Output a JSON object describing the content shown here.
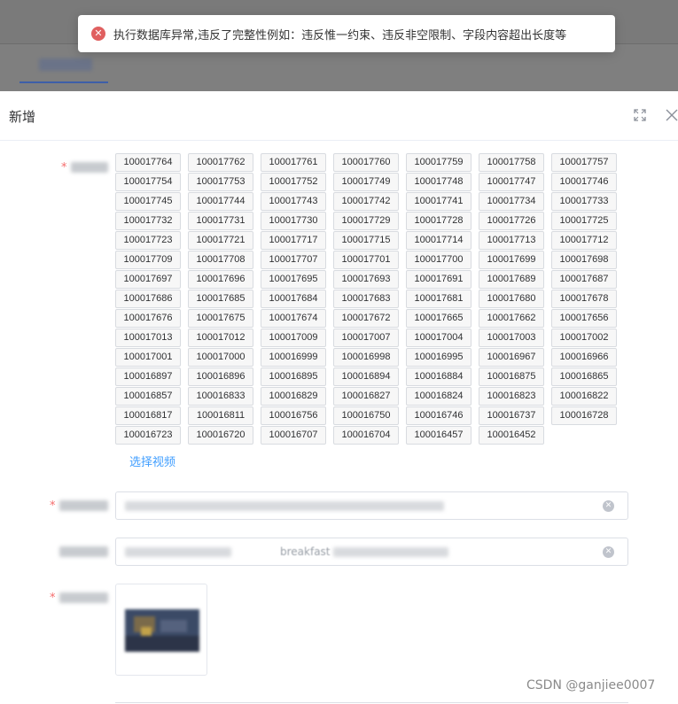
{
  "toast": {
    "icon": "error-circle-icon",
    "message": "执行数据库异常,违反了完整性例如：违反惟一约束、违反非空限制、字段内容超出长度等"
  },
  "dialog": {
    "title": "新增",
    "select_video_label": "选择视频",
    "input2_hint": "breakfast"
  },
  "video_ids": [
    "100017764",
    "100017762",
    "100017761",
    "100017760",
    "100017759",
    "100017758",
    "100017757",
    "100017754",
    "100017753",
    "100017752",
    "100017749",
    "100017748",
    "100017747",
    "100017746",
    "100017745",
    "100017744",
    "100017743",
    "100017742",
    "100017741",
    "100017734",
    "100017733",
    "100017732",
    "100017731",
    "100017730",
    "100017729",
    "100017728",
    "100017726",
    "100017725",
    "100017723",
    "100017721",
    "100017717",
    "100017715",
    "100017714",
    "100017713",
    "100017712",
    "100017709",
    "100017708",
    "100017707",
    "100017701",
    "100017700",
    "100017699",
    "100017698",
    "100017697",
    "100017696",
    "100017695",
    "100017693",
    "100017691",
    "100017689",
    "100017687",
    "100017686",
    "100017685",
    "100017684",
    "100017683",
    "100017681",
    "100017680",
    "100017678",
    "100017676",
    "100017675",
    "100017674",
    "100017672",
    "100017665",
    "100017662",
    "100017656",
    "100017013",
    "100017012",
    "100017009",
    "100017007",
    "100017004",
    "100017003",
    "100017002",
    "100017001",
    "100017000",
    "100016999",
    "100016998",
    "100016995",
    "100016967",
    "100016966",
    "100016897",
    "100016896",
    "100016895",
    "100016894",
    "100016884",
    "100016875",
    "100016865",
    "100016857",
    "100016833",
    "100016829",
    "100016827",
    "100016824",
    "100016823",
    "100016822",
    "100016817",
    "100016811",
    "100016756",
    "100016750",
    "100016746",
    "100016737",
    "100016728",
    "100016723",
    "100016720",
    "100016707",
    "100016704",
    "100016457",
    "100016452"
  ],
  "watermark": "CSDN @ganjiee0007",
  "colors": {
    "link": "#409eff",
    "required": "#f56c6c",
    "error": "#e06060"
  }
}
